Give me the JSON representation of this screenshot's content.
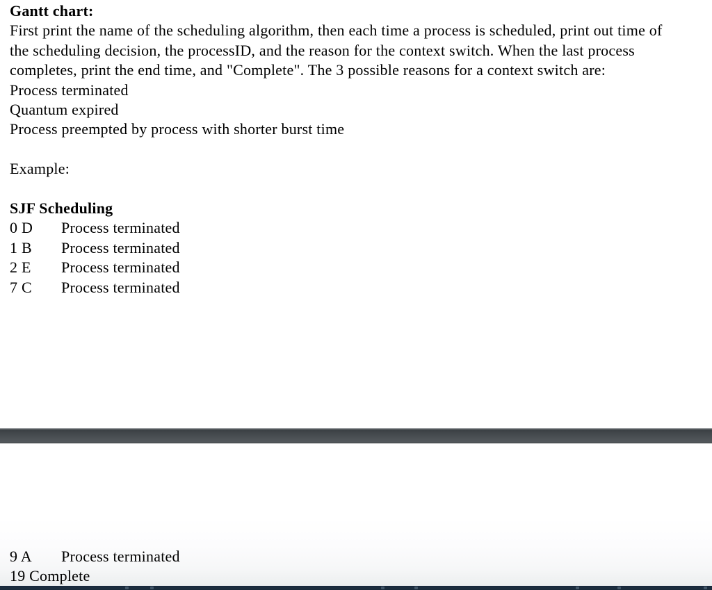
{
  "document": {
    "heading": "Gantt chart:",
    "instructions_paragraph": "First print the name of the scheduling algorithm, then each time a process is scheduled, print out time of the scheduling decision, the processID, and the reason for the context switch.  When the last process completes, print the end time, and \"Complete\".  The 3 possible reasons for a context switch are:",
    "reasons": [
      "Process terminated",
      "Quantum expired",
      "Process preempted by process with shorter burst time"
    ],
    "example_label": "Example:",
    "example": {
      "title": "SJF Scheduling",
      "rows": [
        {
          "time": "0",
          "pid": "D",
          "reason": "Process terminated"
        },
        {
          "time": "1",
          "pid": "B",
          "reason": "Process terminated"
        },
        {
          "time": "2",
          "pid": "E",
          "reason": "Process terminated"
        },
        {
          "time": "7",
          "pid": "C",
          "reason": "Process terminated"
        }
      ]
    }
  },
  "lower_pane": {
    "rows": [
      {
        "time": "9",
        "pid": "A",
        "reason": "Process terminated"
      }
    ],
    "final_line": "19 Complete"
  },
  "colors": {
    "page_background": "#ffffff",
    "text": "#000000",
    "splitter_bar_dark": "#3a3f43",
    "splitter_bar_light": "#53585c",
    "taskbar_strip": "#1d2e3f"
  }
}
